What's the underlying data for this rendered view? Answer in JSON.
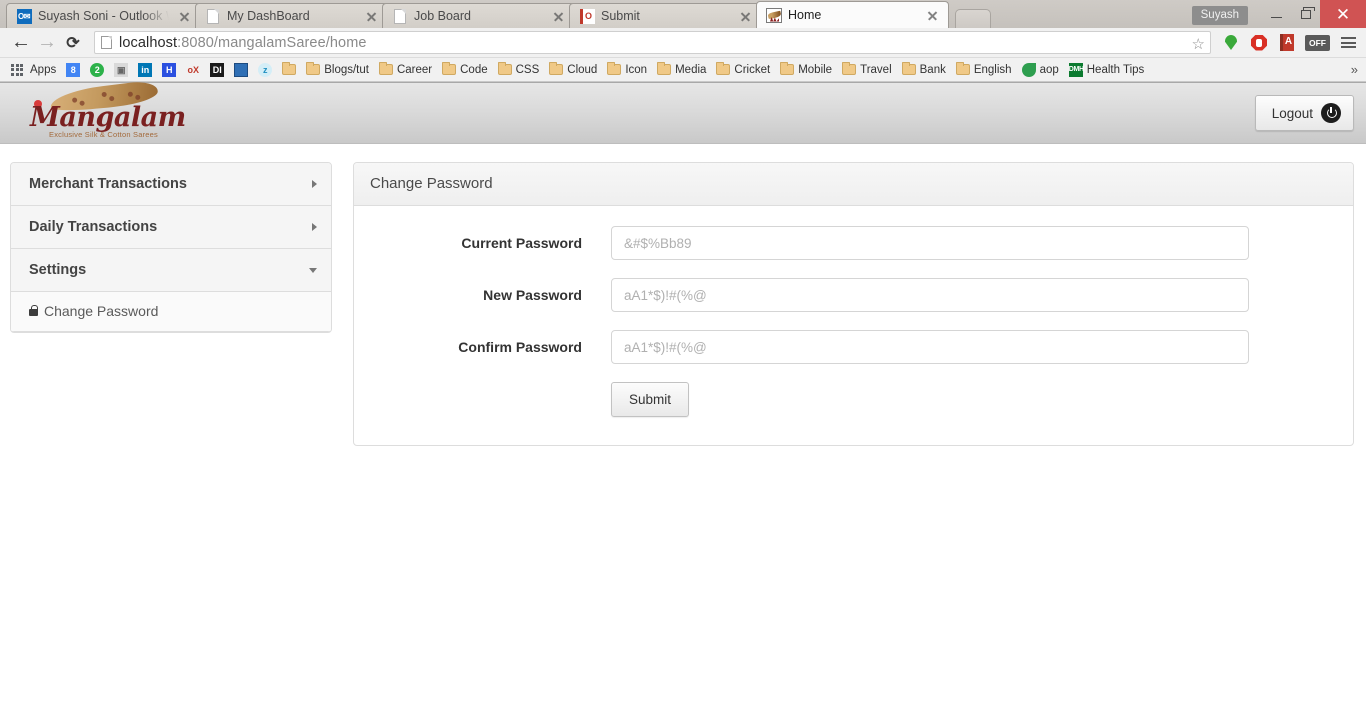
{
  "browser": {
    "tabs": [
      {
        "title": "Suyash Soni - Outlook We",
        "favicon": "outlook-icon",
        "active": false
      },
      {
        "title": "My DashBoard",
        "favicon": "document-icon",
        "active": false
      },
      {
        "title": "Job Board",
        "favicon": "document-icon",
        "active": false
      },
      {
        "title": "Submit",
        "favicon": "outlook-submit-icon",
        "active": false
      },
      {
        "title": "Home",
        "favicon": "mangalam-site-icon",
        "active": true
      }
    ],
    "window": {
      "user_badge": "Suyash",
      "minimize": "minimize-icon",
      "maximize": "maximize-icon",
      "close": "close-icon"
    },
    "toolbar": {
      "back": "back-arrow-icon",
      "forward": "forward-arrow-icon",
      "reload": "reload-icon",
      "url_host": "localhost",
      "url_rest": ":8080/mangalamSaree/home",
      "url_full": "localhost:8080/mangalamSaree/home",
      "bookmark_star": "star-icon",
      "extensions": [
        {
          "name": "green-pin-icon",
          "label": ""
        },
        {
          "name": "adblock-stop-icon",
          "label": ""
        },
        {
          "name": "dictionary-book-icon",
          "label": ""
        },
        {
          "name": "off-toggle-icon",
          "label": "OFF"
        }
      ],
      "menu": "hamburger-menu-icon"
    },
    "bookmarks": {
      "apps_label": "Apps",
      "items": [
        {
          "label": "",
          "icon": "google-icon"
        },
        {
          "label": "",
          "icon": "green-two-icon"
        },
        {
          "label": "",
          "icon": "grey-photo-icon"
        },
        {
          "label": "",
          "icon": "linkedin-icon"
        },
        {
          "label": "",
          "icon": "blue-h-icon"
        },
        {
          "label": "",
          "icon": "ox-icon"
        },
        {
          "label": "",
          "icon": "di-icon"
        },
        {
          "label": "",
          "icon": "monitor-icon"
        },
        {
          "label": "",
          "icon": "zoho-icon"
        },
        {
          "label": "",
          "icon": "folder-icon"
        },
        {
          "label": "Blogs/tut",
          "icon": "folder-icon"
        },
        {
          "label": "Career",
          "icon": "folder-icon"
        },
        {
          "label": "Code",
          "icon": "folder-icon"
        },
        {
          "label": "CSS",
          "icon": "folder-icon"
        },
        {
          "label": "Cloud",
          "icon": "folder-icon"
        },
        {
          "label": "Icon",
          "icon": "folder-icon"
        },
        {
          "label": "Media",
          "icon": "folder-icon"
        },
        {
          "label": "Cricket",
          "icon": "folder-icon"
        },
        {
          "label": "Mobile",
          "icon": "folder-icon"
        },
        {
          "label": "Travel",
          "icon": "folder-icon"
        },
        {
          "label": "Bank",
          "icon": "folder-icon"
        },
        {
          "label": "English",
          "icon": "folder-icon"
        },
        {
          "label": "aop",
          "icon": "leaf-icon"
        },
        {
          "label": "Health Tips",
          "icon": "dmh-icon"
        }
      ],
      "overflow": "»"
    }
  },
  "page": {
    "header": {
      "logo_word": "Mangalam",
      "logo_tagline": "Exclusive Silk & Cotton Sarees",
      "logout_label": "Logout",
      "logout_icon": "power-icon"
    },
    "sidebar": {
      "items": [
        {
          "label": "Merchant Transactions",
          "expanded": false,
          "caret": "caret-right-icon"
        },
        {
          "label": "Daily Transactions",
          "expanded": false,
          "caret": "caret-right-icon"
        },
        {
          "label": "Settings",
          "expanded": true,
          "caret": "caret-down-icon"
        }
      ],
      "settings_children": [
        {
          "label": "Change Password",
          "icon": "lock-icon"
        }
      ]
    },
    "panel": {
      "title": "Change Password",
      "fields": [
        {
          "label": "Current Password",
          "value": "",
          "placeholder": "&#$%Bb89"
        },
        {
          "label": "New Password",
          "value": "",
          "placeholder": "aA1*$)!#(%@"
        },
        {
          "label": "Confirm Password",
          "value": "",
          "placeholder": "aA1*$)!#(%@"
        }
      ],
      "submit_label": "Submit"
    }
  },
  "colors": {
    "logo_maroon": "#7a2020",
    "logo_tan": "#c49a5f",
    "close_red": "#d05353",
    "panel_border": "#dddddd"
  }
}
